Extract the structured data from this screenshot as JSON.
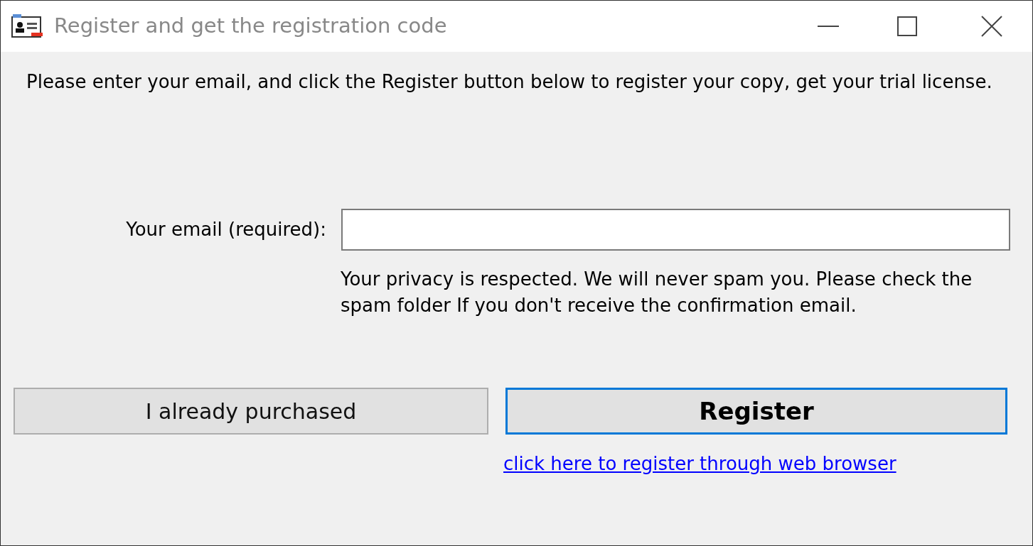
{
  "window": {
    "title": "Register and get the registration code"
  },
  "instructions": "Please enter your email, and click the Register button below to register your copy, get your trial license.",
  "email_field": {
    "label": "Your email (required):"
  },
  "privacy_note": "Your privacy is respected. We will never spam you. Please check the spam folder If you don't receive the confirmation email.",
  "buttons": [
    {
      "label": "I already purchased",
      "kind": "normal"
    },
    {
      "label": "Register",
      "kind": "default"
    }
  ],
  "link": "click here to register through web browser"
}
